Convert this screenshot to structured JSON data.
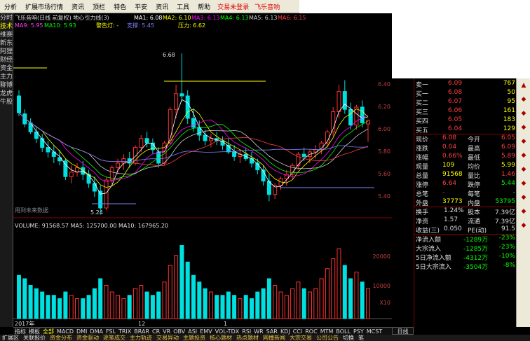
{
  "menu": {
    "items": [
      "分析",
      "扩展市场行情",
      "资讯",
      "顶栏",
      "特色",
      "平安",
      "资讯",
      "工具",
      "帮助"
    ],
    "status_login": "交易未登录",
    "status_brand": "飞乐音响"
  },
  "left_tabs": [
    "分时走势",
    "技术分析",
    "维赛特",
    "新东方",
    "阿狸",
    "财经通",
    "资金流向",
    "主力监控",
    "聊博士",
    "龙虎榜",
    "牛股宝"
  ],
  "chart": {
    "title": "飞乐音响(日线 前复权) 地心引力线(3)",
    "ma_labels": [
      {
        "text": "MA1: 6.08",
        "color": "#ffffff"
      },
      {
        "text": "MA2: 6.10",
        "color": "#ffff00"
      },
      {
        "text": "MA3: 6.13",
        "color": "#ff00ff"
      },
      {
        "text": "MA4: 6.13",
        "color": "#00ff00"
      },
      {
        "text": "MA5: 6.13",
        "color": "#cccccc"
      },
      {
        "text": "MA6: 6.15",
        "color": "#ff4040"
      }
    ],
    "ma_labels2": [
      {
        "text": "MA9: 5.95",
        "color": "#ff40ff"
      },
      {
        "text": "MA10: 5.93",
        "color": "#00ff00"
      }
    ],
    "warn_label": "警告灯: -",
    "support_label": "支撑: 5.45",
    "resistance_label": "压力: 6.62",
    "high_label": "6.68",
    "low_label": "5.24",
    "future_label": "用到未来数据",
    "y_ticks": [
      "6.40",
      "6.20",
      "6.00",
      "5.80",
      "5.60",
      "5.40"
    ],
    "volume_line": "VOLUME: 91568.57  MA5: 125700.00  MA10: 167965.20",
    "vol_ticks": [
      "20000",
      "10000"
    ],
    "vol_unit": "X10",
    "date_label": "2017年",
    "month_label": "12",
    "tail_label": "1",
    "period_label": "日线"
  },
  "tabs": [
    "指标",
    "模板",
    "全部",
    "MACD",
    "DMI",
    "DMA",
    "FSL",
    "TRIX",
    "BRAR",
    "CR",
    "VR",
    "OBV",
    "ASI",
    "EMV",
    "VOL-TDX",
    "RSI",
    "WR",
    "SAR",
    "KDJ",
    "CCI",
    "ROC",
    "MTM",
    "BOLL",
    "PSY",
    "MCST"
  ],
  "bottom_tabs": [
    "扩展区",
    "关联报价",
    "资金分布",
    "资金驱动",
    "逐笔成交",
    "主力轨迹",
    "交易异动",
    "主题投资",
    "核心题材",
    "热点题材",
    "网播新闻",
    "大宗交易",
    "公司公告",
    "切换",
    "笔"
  ],
  "quote": {
    "asks": [
      {
        "label": "卖一",
        "price": "6.09",
        "vol": "767"
      },
      {
        "label": "买一",
        "price": "6.08",
        "vol": "50"
      },
      {
        "label": "买二",
        "price": "6.07",
        "vol": "95"
      },
      {
        "label": "买三",
        "price": "6.06",
        "vol": "161"
      },
      {
        "label": "买四",
        "price": "6.05",
        "vol": "183"
      },
      {
        "label": "买五",
        "price": "6.04",
        "vol": "129"
      }
    ],
    "rows": [
      {
        "l1": "现价",
        "v1": "6.08",
        "l2": "今开",
        "v2": "6.05"
      },
      {
        "l1": "涨跌",
        "v1": "0.04",
        "l2": "最高",
        "v2": "6.09"
      },
      {
        "l1": "涨幅",
        "v1": "0.66%",
        "l2": "最低",
        "v2": "5.89"
      },
      {
        "l1": "现量",
        "v1": "109",
        "l2": "均价",
        "v2": "5.99"
      },
      {
        "l1": "总量",
        "v1": "91568",
        "l2": "量比",
        "v2": "1.46"
      },
      {
        "l1": "涨停",
        "v1": "6.64",
        "l2": "跌停",
        "v2": "5.44"
      },
      {
        "l1": "总笔",
        "v1": "-",
        "l2": "每笔",
        "v2": "-"
      },
      {
        "l1": "外盘",
        "v1": "37773",
        "l2": "内盘",
        "v2": "53795"
      }
    ],
    "stats": [
      {
        "l1": "换手",
        "v1": "1.24%",
        "l2": "股本",
        "v2": "7.39亿"
      },
      {
        "l1": "净资",
        "v1": "1.57",
        "l2": "流通",
        "v2": "7.39亿"
      },
      {
        "l1": "收益(三)",
        "v1": "0.050",
        "l2": "PE(动)",
        "v2": "91.5"
      }
    ],
    "flows": [
      {
        "l": "净流入额",
        "v1": "-1289万",
        "v2": "-23%"
      },
      {
        "l": "大宗流入",
        "v1": "-1285万",
        "v2": "-23%"
      },
      {
        "l": "5日净流入额",
        "v1": "-4312万",
        "v2": "-10%"
      },
      {
        "l": "5日大宗流入",
        "v1": "-3504万",
        "v2": "-8%"
      }
    ]
  },
  "candles": [
    {
      "o": 6.3,
      "h": 6.35,
      "l": 6.12,
      "c": 6.15
    },
    {
      "o": 6.14,
      "h": 6.18,
      "l": 6.02,
      "c": 6.05
    },
    {
      "o": 6.06,
      "h": 6.1,
      "l": 5.96,
      "c": 5.98
    },
    {
      "o": 5.98,
      "h": 6.02,
      "l": 5.88,
      "c": 5.92
    },
    {
      "o": 5.92,
      "h": 5.96,
      "l": 5.8,
      "c": 5.84
    },
    {
      "o": 5.84,
      "h": 5.9,
      "l": 5.75,
      "c": 5.8
    },
    {
      "o": 5.8,
      "h": 5.86,
      "l": 5.7,
      "c": 5.76
    },
    {
      "o": 5.75,
      "h": 5.82,
      "l": 5.68,
      "c": 5.72
    },
    {
      "o": 5.72,
      "h": 5.74,
      "l": 5.55,
      "c": 5.58
    },
    {
      "o": 5.58,
      "h": 5.68,
      "l": 5.52,
      "c": 5.62
    },
    {
      "o": 5.62,
      "h": 5.7,
      "l": 5.58,
      "c": 5.66
    },
    {
      "o": 5.66,
      "h": 5.72,
      "l": 5.55,
      "c": 5.6
    },
    {
      "o": 5.6,
      "h": 5.64,
      "l": 5.48,
      "c": 5.52
    },
    {
      "o": 5.52,
      "h": 5.58,
      "l": 5.4,
      "c": 5.45
    },
    {
      "o": 5.45,
      "h": 5.5,
      "l": 5.24,
      "c": 5.3
    },
    {
      "o": 5.3,
      "h": 5.58,
      "l": 5.28,
      "c": 5.55
    },
    {
      "o": 5.55,
      "h": 5.68,
      "l": 5.5,
      "c": 5.66
    },
    {
      "o": 5.66,
      "h": 5.74,
      "l": 5.6,
      "c": 5.7
    },
    {
      "o": 5.7,
      "h": 5.78,
      "l": 5.64,
      "c": 5.74
    },
    {
      "o": 5.74,
      "h": 5.8,
      "l": 5.66,
      "c": 5.7
    },
    {
      "o": 5.7,
      "h": 5.86,
      "l": 5.68,
      "c": 5.84
    },
    {
      "o": 5.84,
      "h": 5.95,
      "l": 5.8,
      "c": 5.92
    },
    {
      "o": 5.92,
      "h": 5.98,
      "l": 5.84,
      "c": 5.88
    },
    {
      "o": 5.88,
      "h": 5.92,
      "l": 5.78,
      "c": 5.82
    },
    {
      "o": 5.8,
      "h": 5.84,
      "l": 5.66,
      "c": 5.7
    },
    {
      "o": 5.7,
      "h": 5.9,
      "l": 5.68,
      "c": 5.88
    },
    {
      "o": 5.88,
      "h": 6.2,
      "l": 5.86,
      "c": 6.18
    },
    {
      "o": 6.18,
      "h": 6.4,
      "l": 6.1,
      "c": 6.32
    },
    {
      "o": 6.32,
      "h": 6.68,
      "l": 6.25,
      "c": 6.3
    },
    {
      "o": 6.3,
      "h": 6.35,
      "l": 6.05,
      "c": 6.1
    },
    {
      "o": 6.1,
      "h": 6.18,
      "l": 5.98,
      "c": 6.02
    },
    {
      "o": 6.02,
      "h": 6.08,
      "l": 5.9,
      "c": 5.95
    },
    {
      "o": 5.95,
      "h": 6.0,
      "l": 5.86,
      "c": 5.9
    },
    {
      "o": 5.9,
      "h": 5.96,
      "l": 5.84,
      "c": 5.92
    },
    {
      "o": 5.92,
      "h": 5.98,
      "l": 5.86,
      "c": 5.9
    },
    {
      "o": 5.9,
      "h": 5.94,
      "l": 5.82,
      "c": 5.86
    },
    {
      "o": 5.86,
      "h": 5.92,
      "l": 5.78,
      "c": 5.8
    },
    {
      "o": 5.8,
      "h": 5.86,
      "l": 5.72,
      "c": 5.76
    },
    {
      "o": 5.76,
      "h": 5.82,
      "l": 5.7,
      "c": 5.78
    },
    {
      "o": 5.78,
      "h": 5.84,
      "l": 5.72,
      "c": 5.74
    },
    {
      "o": 5.74,
      "h": 5.8,
      "l": 5.66,
      "c": 5.7
    },
    {
      "o": 5.7,
      "h": 5.74,
      "l": 5.6,
      "c": 5.64
    },
    {
      "o": 5.64,
      "h": 5.68,
      "l": 5.5,
      "c": 5.54
    },
    {
      "o": 5.54,
      "h": 5.6,
      "l": 5.36,
      "c": 5.42
    },
    {
      "o": 5.42,
      "h": 5.52,
      "l": 5.38,
      "c": 5.5
    },
    {
      "o": 5.5,
      "h": 5.58,
      "l": 5.46,
      "c": 5.56
    },
    {
      "o": 5.56,
      "h": 5.64,
      "l": 5.5,
      "c": 5.6
    },
    {
      "o": 5.6,
      "h": 5.7,
      "l": 5.56,
      "c": 5.68
    },
    {
      "o": 5.68,
      "h": 5.8,
      "l": 5.64,
      "c": 5.78
    },
    {
      "o": 5.78,
      "h": 5.84,
      "l": 5.72,
      "c": 5.76
    },
    {
      "o": 5.76,
      "h": 5.82,
      "l": 5.7,
      "c": 5.8
    },
    {
      "o": 5.8,
      "h": 5.86,
      "l": 5.74,
      "c": 5.82
    },
    {
      "o": 5.82,
      "h": 5.9,
      "l": 5.78,
      "c": 5.88
    },
    {
      "o": 5.88,
      "h": 6.0,
      "l": 5.84,
      "c": 5.98
    },
    {
      "o": 5.98,
      "h": 6.2,
      "l": 5.94,
      "c": 6.16
    },
    {
      "o": 6.16,
      "h": 6.4,
      "l": 6.1,
      "c": 6.34
    },
    {
      "o": 6.34,
      "h": 6.44,
      "l": 6.14,
      "c": 6.18
    },
    {
      "o": 6.18,
      "h": 6.24,
      "l": 6.0,
      "c": 6.04
    },
    {
      "o": 6.04,
      "h": 6.22,
      "l": 6.0,
      "c": 6.2
    },
    {
      "o": 6.2,
      "h": 6.26,
      "l": 6.02,
      "c": 6.06
    },
    {
      "o": 6.05,
      "h": 6.09,
      "l": 5.89,
      "c": 6.08
    }
  ],
  "volumes": [
    13,
    12,
    10,
    9,
    8,
    7,
    7,
    6,
    8,
    7,
    6,
    6,
    7,
    9,
    12,
    10,
    8,
    7,
    6,
    7,
    9,
    10,
    8,
    7,
    8,
    11,
    16,
    19,
    22,
    17,
    13,
    11,
    9,
    8,
    7,
    7,
    8,
    7,
    6,
    7,
    6,
    8,
    9,
    12,
    10,
    8,
    7,
    9,
    11,
    9,
    8,
    9,
    12,
    15,
    18,
    21,
    16,
    12,
    14,
    11,
    9
  ]
}
